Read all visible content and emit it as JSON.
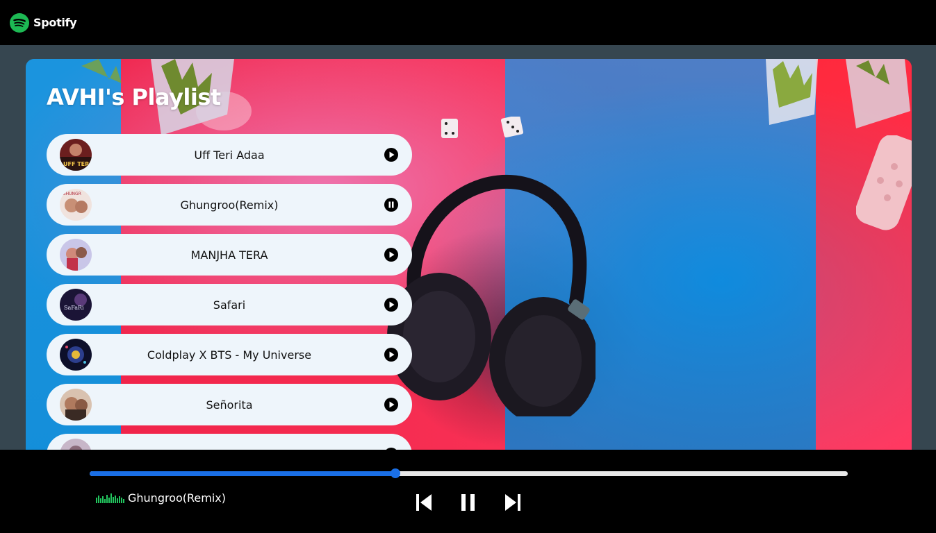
{
  "app": {
    "name": "Spotify",
    "brand_color": "#1db954"
  },
  "playlist": {
    "title": "AVHI's Playlist",
    "songs": [
      {
        "title": "Uff Teri Adaa",
        "state": "play",
        "icon": "play-icon"
      },
      {
        "title": "Ghungroo(Remix)",
        "state": "pause",
        "icon": "pause-icon"
      },
      {
        "title": "MANJHA TERA",
        "state": "play",
        "icon": "play-icon"
      },
      {
        "title": "Safari",
        "state": "play",
        "icon": "play-icon"
      },
      {
        "title": "Coldplay X BTS - My Universe",
        "state": "play",
        "icon": "play-icon"
      },
      {
        "title": "Señorita",
        "state": "play",
        "icon": "play-icon"
      },
      {
        "title": "",
        "state": "play",
        "icon": "play-icon"
      }
    ]
  },
  "player": {
    "now_playing": "Ghungroo(Remix)",
    "progress_fraction": 0.403,
    "accent": "#1a6fe6",
    "controls": [
      "previous-icon",
      "pause-icon",
      "next-icon"
    ]
  }
}
